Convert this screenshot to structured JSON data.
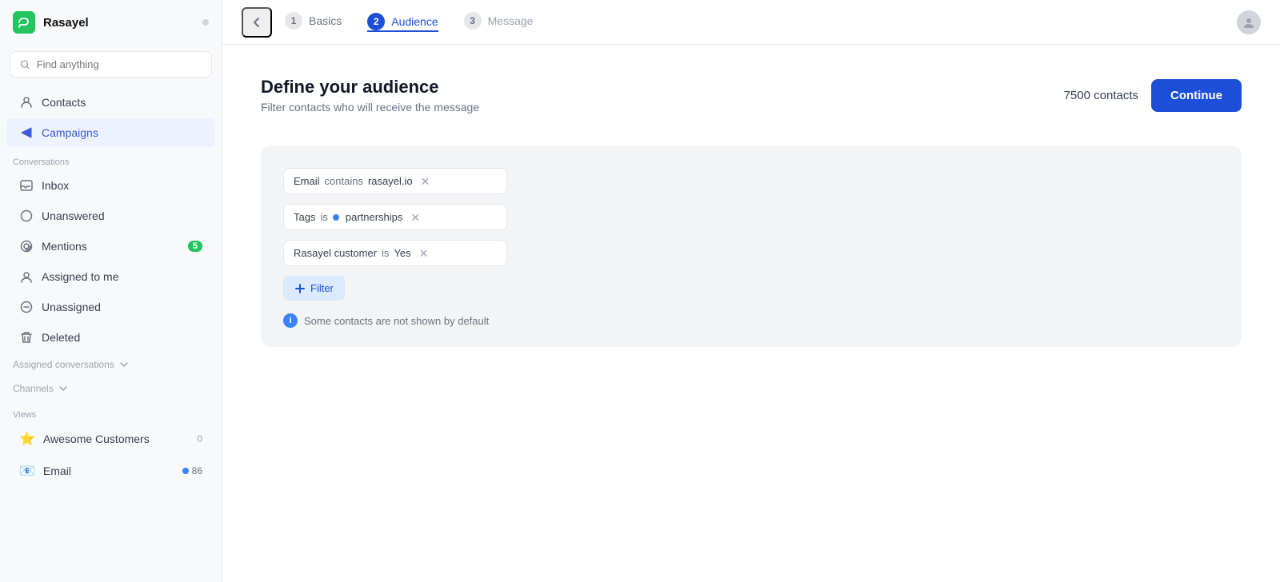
{
  "app": {
    "name": "Rasayel"
  },
  "sidebar": {
    "search_placeholder": "Find anything",
    "nav": [
      {
        "id": "contacts",
        "label": "Contacts",
        "icon": "contacts-icon",
        "active": false
      },
      {
        "id": "campaigns",
        "label": "Campaigns",
        "icon": "campaigns-icon",
        "active": true
      }
    ],
    "conversations_label": "Conversations",
    "conversations": [
      {
        "id": "inbox",
        "label": "Inbox",
        "icon": "inbox-icon"
      },
      {
        "id": "unanswered",
        "label": "Unanswered",
        "icon": "unanswered-icon"
      },
      {
        "id": "mentions",
        "label": "Mentions",
        "icon": "mentions-icon",
        "badge": "5"
      },
      {
        "id": "assigned",
        "label": "Assigned to me",
        "icon": "assigned-icon"
      },
      {
        "id": "unassigned",
        "label": "Unassigned",
        "icon": "unassigned-icon"
      },
      {
        "id": "deleted",
        "label": "Deleted",
        "icon": "deleted-icon"
      }
    ],
    "assigned_conversations_label": "Assigned conversations",
    "channels_label": "Channels",
    "views_label": "Views",
    "views": [
      {
        "id": "awesome-customers",
        "label": "Awesome Customers",
        "icon": "star-icon",
        "count": "0"
      },
      {
        "id": "email",
        "label": "Email",
        "icon": "email-view-icon",
        "badge_dot": true,
        "count": "86"
      }
    ]
  },
  "topbar": {
    "back_label": "Back",
    "steps": [
      {
        "num": "1",
        "label": "Basics",
        "state": "completed"
      },
      {
        "num": "2",
        "label": "Audience",
        "state": "active"
      },
      {
        "num": "3",
        "label": "Message",
        "state": "default"
      }
    ]
  },
  "main": {
    "title": "Define your audience",
    "subtitle": "Filter contacts who will receive the message",
    "contacts_count": "7500 contacts",
    "continue_label": "Continue",
    "filters": [
      {
        "id": "filter-email",
        "field": "Email",
        "op": "contains",
        "value": "rasayel.io",
        "type": "text"
      },
      {
        "id": "filter-tags",
        "field": "Tags",
        "op": "is",
        "value": "partnerships",
        "type": "tag"
      },
      {
        "id": "filter-customer",
        "field": "Rasayel customer",
        "op": "is",
        "value": "Yes",
        "type": "text"
      }
    ],
    "add_filter_label": "Filter",
    "info_text": "Some contacts are not shown by default"
  }
}
